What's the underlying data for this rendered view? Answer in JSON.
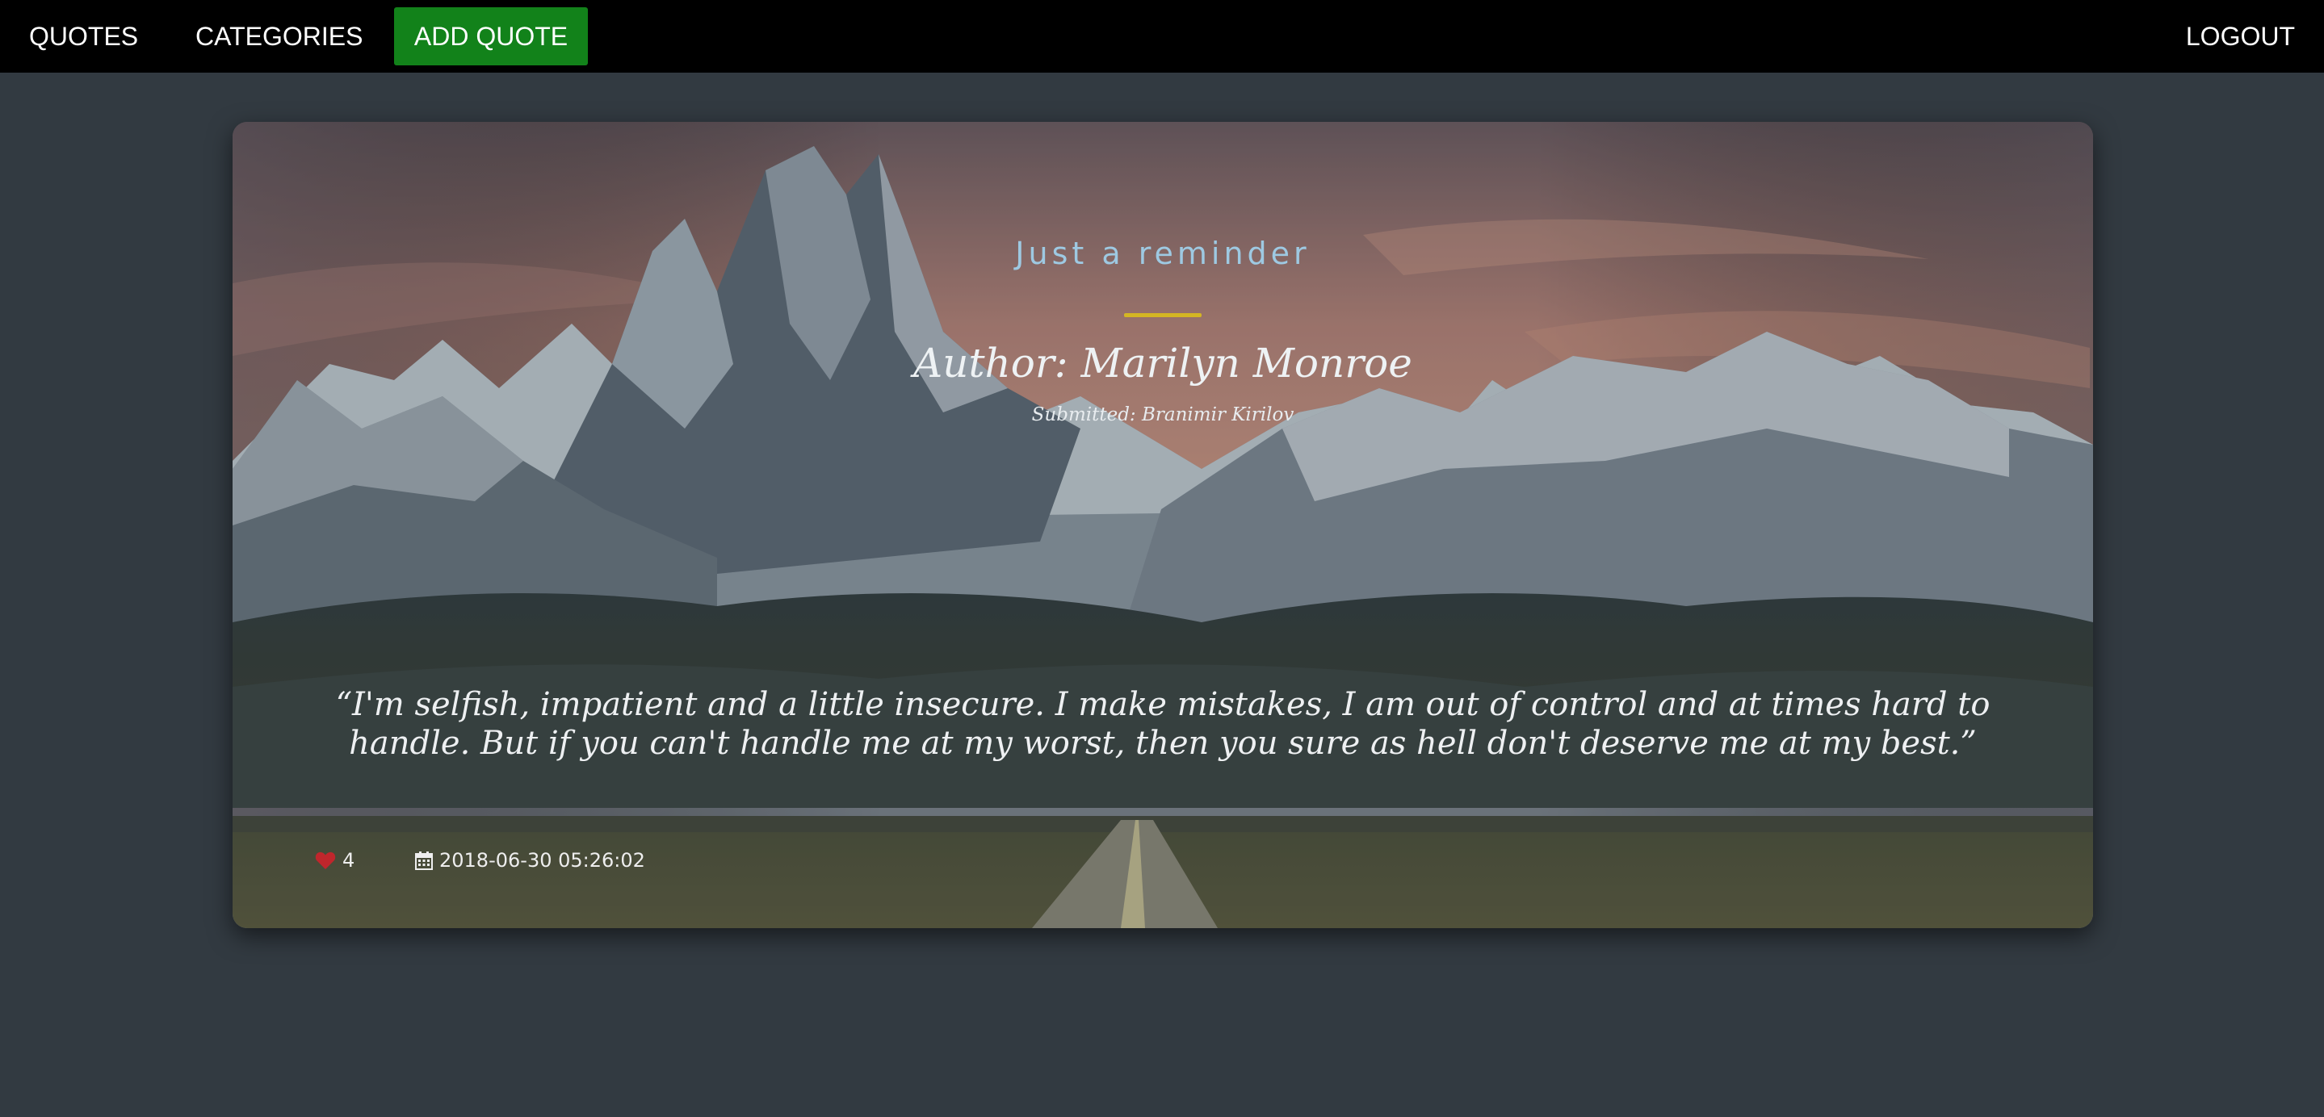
{
  "nav": {
    "quotes": "QUOTES",
    "categories": "CATEGORIES",
    "add_quote": "ADD QUOTE",
    "logout": "LOGOUT"
  },
  "colors": {
    "navbar_bg": "#000000",
    "add_button_bg": "#12821a",
    "page_bg": "#323a41",
    "title_color": "#9ec9e2",
    "rule_color": "#d4b623",
    "heart_color": "#c0262c"
  },
  "quote_card": {
    "category_title": "Just a reminder",
    "author": "Author: Marilyn Monroe",
    "submitted": "Submitted: Branimir Kirilov",
    "quote_text": "“I'm selfish, impatient and a little insecure. I make mistakes, I am out of control and at times hard to handle. But if you can't handle me at my worst, then you sure as hell don't deserve me at my best.”",
    "likes": "4",
    "date": "2018-06-30 05:26:02",
    "icons": {
      "likes": "heart-icon",
      "date": "calendar-icon"
    }
  }
}
